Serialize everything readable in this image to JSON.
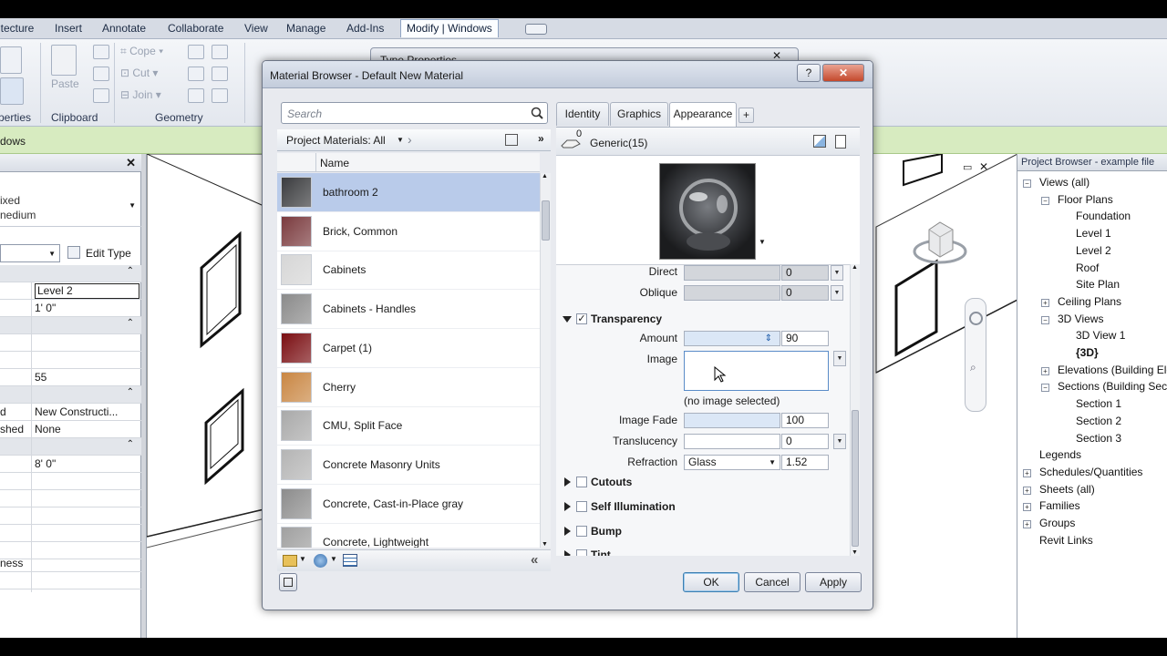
{
  "menubar": {
    "items": [
      "itecture",
      "Insert",
      "Annotate",
      "Collaborate",
      "View",
      "Manage",
      "Add-Ins"
    ],
    "active": "Modify | Windows"
  },
  "ribbon": {
    "panels": [
      "perties",
      "Clipboard",
      "Geometry"
    ],
    "buttons": {
      "paste": "Paste",
      "cope": "Cope",
      "cut": "Cut",
      "join": "Join"
    }
  },
  "greenbar": {
    "label": "dows"
  },
  "properties": {
    "type_line1": "ixed",
    "type_line2": "nedium",
    "edit_type": "Edit Type",
    "rows": [
      {
        "c1": "",
        "c2": "Level 2"
      },
      {
        "c1": "",
        "c2": "1'  0\""
      },
      {
        "c1": "",
        "c2": "55"
      },
      {
        "c1": "d",
        "c2": "New Constructi..."
      },
      {
        "c1": "shed",
        "c2": "None"
      },
      {
        "c1": "",
        "c2": "8'  0\""
      },
      {
        "c1": "ness",
        "c2": ""
      }
    ]
  },
  "type_properties": {
    "title": "Type Properties"
  },
  "dialog": {
    "title": "Material Browser - Default New Material",
    "help": "?",
    "close": "✕",
    "search_placeholder": "Search",
    "filter_label": "Project Materials: All",
    "name_header": "Name",
    "materials": [
      {
        "name": "bathroom 2",
        "selected": true,
        "color": "#3a3b3e"
      },
      {
        "name": "Brick, Common",
        "selected": false,
        "color": "#7a3a3e"
      },
      {
        "name": "Cabinets",
        "selected": false,
        "color": "#d6d6d6"
      },
      {
        "name": "Cabinets - Handles",
        "selected": false,
        "color": "#8a8a8a"
      },
      {
        "name": "Carpet (1)",
        "selected": false,
        "color": "#7a0e12"
      },
      {
        "name": "Cherry",
        "selected": false,
        "color": "#c98642"
      },
      {
        "name": "CMU, Split Face",
        "selected": false,
        "color": "#a9a9a9"
      },
      {
        "name": "Concrete Masonry Units",
        "selected": false,
        "color": "#b4b4b4"
      },
      {
        "name": "Concrete, Cast-in-Place gray",
        "selected": false,
        "color": "#8c8c8c"
      },
      {
        "name": "Concrete, Lightweight",
        "selected": false,
        "color": "#a0a0a0"
      }
    ],
    "tabs": [
      "Identity",
      "Graphics",
      "Appearance"
    ],
    "active_tab": "Appearance",
    "add_tab": "+",
    "asset": {
      "count": "0",
      "name": "Generic(15)"
    },
    "appearance": {
      "direct_label": "Direct",
      "direct_value": "0",
      "oblique_label": "Oblique",
      "oblique_value": "0",
      "transparency": "Transparency",
      "amount_label": "Amount",
      "amount_value": "90",
      "image_label": "Image",
      "no_image": "(no image selected)",
      "fade_label": "Image Fade",
      "fade_value": "100",
      "translucency_label": "Translucency",
      "translucency_value": "0",
      "refraction_label": "Refraction",
      "refraction_type": "Glass",
      "refraction_value": "1.52",
      "sections": [
        "Cutouts",
        "Self Illumination",
        "Bump",
        "Tint"
      ]
    },
    "buttons": {
      "ok": "OK",
      "cancel": "Cancel",
      "apply": "Apply"
    }
  },
  "project_browser": {
    "title": "Project Browser - example file",
    "items": [
      {
        "label": "Views (all)",
        "level": 0,
        "box": "−"
      },
      {
        "label": "Floor Plans",
        "level": 1,
        "box": "−"
      },
      {
        "label": "Foundation",
        "level": 2,
        "box": ""
      },
      {
        "label": "Level 1",
        "level": 2,
        "box": ""
      },
      {
        "label": "Level 2",
        "level": 2,
        "box": ""
      },
      {
        "label": "Roof",
        "level": 2,
        "box": ""
      },
      {
        "label": "Site Plan",
        "level": 2,
        "box": ""
      },
      {
        "label": "Ceiling Plans",
        "level": 1,
        "box": "+"
      },
      {
        "label": "3D Views",
        "level": 1,
        "box": "−"
      },
      {
        "label": "3D View 1",
        "level": 2,
        "box": ""
      },
      {
        "label": "{3D}",
        "level": 2,
        "box": "",
        "bold": true
      },
      {
        "label": "Elevations (Building Elevation)",
        "level": 1,
        "box": "+"
      },
      {
        "label": "Sections (Building Section)",
        "level": 1,
        "box": "−"
      },
      {
        "label": "Section 1",
        "level": 2,
        "box": ""
      },
      {
        "label": "Section 2",
        "level": 2,
        "box": ""
      },
      {
        "label": "Section 3",
        "level": 2,
        "box": ""
      },
      {
        "label": "Legends",
        "level": 0,
        "box": ""
      },
      {
        "label": "Schedules/Quantities",
        "level": 0,
        "box": "+"
      },
      {
        "label": "Sheets (all)",
        "level": 0,
        "box": "+"
      },
      {
        "label": "Families",
        "level": 0,
        "box": "+"
      },
      {
        "label": "Groups",
        "level": 0,
        "box": "+"
      },
      {
        "label": "Revit Links",
        "level": 0,
        "box": ""
      }
    ]
  },
  "colors": {
    "selection": "#b9cbea",
    "greenbar": "#d7ebc0",
    "ribbon": "#e3e7ee"
  }
}
